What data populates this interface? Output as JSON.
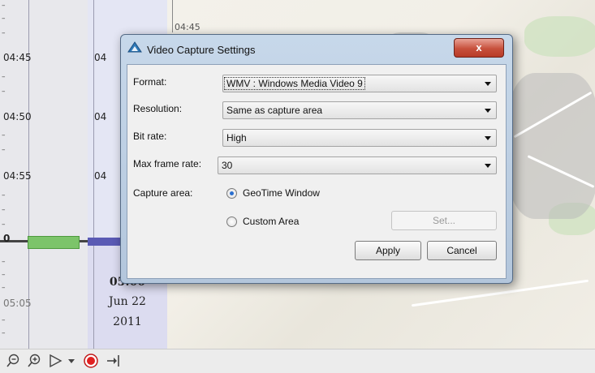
{
  "timeline": {
    "times": [
      "04:45",
      "04:50",
      "04:55",
      "05:05"
    ],
    "mid_times": [
      "04",
      "04",
      "04"
    ],
    "cut_label": "0",
    "current_time": "05:00",
    "date_line": "Jun 22",
    "year_line": "2011",
    "map_time": "04:45"
  },
  "toolbar": {
    "icons": [
      "zoom-out-icon",
      "zoom-in-icon",
      "play-icon",
      "dropdown-icon",
      "record-icon",
      "export-icon"
    ]
  },
  "dialog": {
    "title": "Video Capture Settings",
    "close_label": "x",
    "fields": {
      "format_label": "Format:",
      "format_value": "WMV : Windows Media Video 9",
      "resolution_label": "Resolution:",
      "resolution_value": "Same as capture area",
      "bitrate_label": "Bit rate:",
      "bitrate_value": "High",
      "framerate_label": "Max frame rate:",
      "framerate_value": "30"
    },
    "capture_area": {
      "label": "Capture area:",
      "option_geotime": "GeoTime Window",
      "option_custom": "Custom Area",
      "selected": "GeoTime Window",
      "set_label": "Set..."
    },
    "apply_label": "Apply",
    "cancel_label": "Cancel"
  },
  "colors": {
    "accent": "#2a6fcf",
    "close": "#c7503c",
    "record": "#e02020",
    "event_green": "#7cc46a"
  }
}
